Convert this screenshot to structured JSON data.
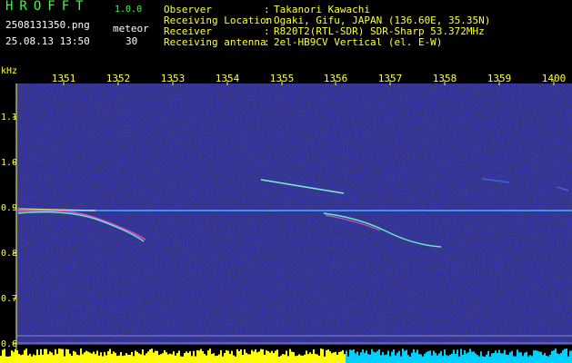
{
  "header": {
    "logo": "HROFFT",
    "version": "1.0.0",
    "filename": "2508131350.png",
    "datetime": "25.08.13 13:50",
    "meteor_label": "meteor",
    "meteor_count": "30",
    "info": [
      {
        "label": "Observer",
        "value": "Takanori Kawachi"
      },
      {
        "label": "Receiving Location",
        "value": "Ogaki, Gifu, JAPAN (136.60E, 35.35N)"
      },
      {
        "label": "Receiver",
        "value": "R820T2(RTL-SDR) SDR-Sharp 53.372MHz"
      },
      {
        "label": "Receiving antenna",
        "value": "2el-HB9CV Vertical (el. E-W)"
      }
    ]
  },
  "axis": {
    "unit": "kHz",
    "x_ticks": [
      "1351",
      "1352",
      "1353",
      "1354",
      "1355",
      "1356",
      "1357",
      "1358",
      "1359",
      "1400"
    ],
    "y_ticks": [
      "1.1",
      "1.0",
      "0.9",
      "0.8",
      "0.7",
      "0.6"
    ]
  },
  "colors": {
    "label_green": "#3cff3c",
    "label_yellow": "#ffff3c",
    "background_noise": "#0a0a3a",
    "carrier": "#44aaff",
    "bottom_bar_yellow": "#ffff00",
    "bottom_bar_cyan": "#00d0ff"
  }
}
